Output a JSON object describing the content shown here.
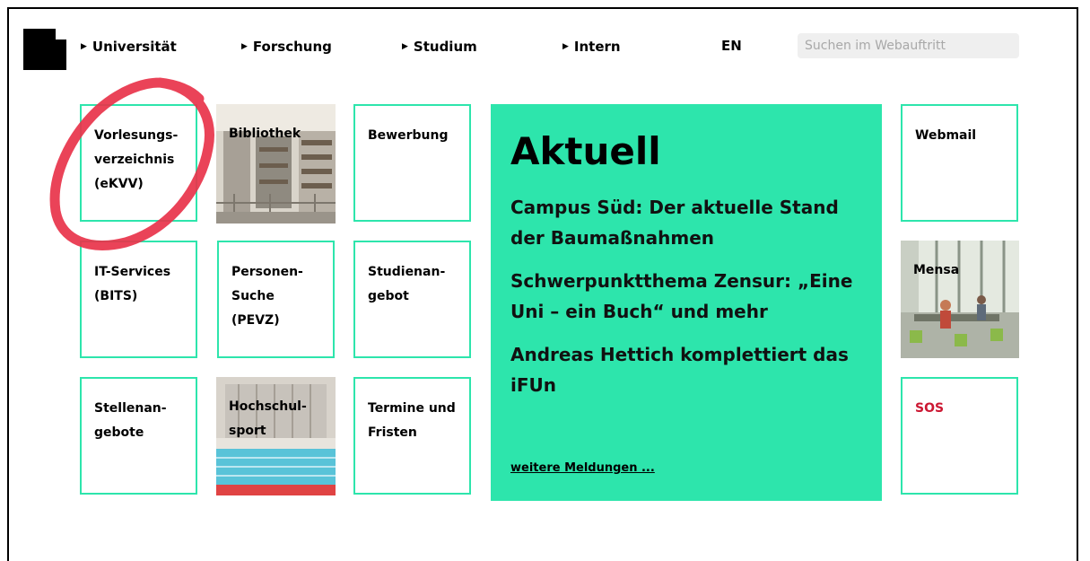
{
  "nav": {
    "items": [
      {
        "label": "Universität"
      },
      {
        "label": "Forschung"
      },
      {
        "label": "Studium"
      },
      {
        "label": "Intern"
      }
    ],
    "lang": "EN",
    "search_placeholder": "Suchen im Webauftritt",
    "caret": "▶"
  },
  "tiles": {
    "vorlesungsverzeichnis": "Vorlesungs-\nverzeichnis\n(eKVV)",
    "bibliothek": "Bibliothek",
    "bewerbung": "Bewerbung",
    "it_services": "IT-Services\n(BITS)",
    "personensuche": "Personen-\nSuche\n(PEVZ)",
    "studienangebot": "Studienan-\ngebot",
    "stellenangebote": "Stellenan-\ngebote",
    "hochschulsport": "Hochschul-\nsport",
    "termine": "Termine und\nFristen",
    "webmail": "Webmail",
    "mensa": "Mensa",
    "sos": "SOS"
  },
  "news": {
    "title": "Aktuell",
    "items": [
      "Campus Süd: Der aktuelle Stand der Baumaßnahmen",
      "Schwerpunktthema Zensur: „Eine Uni – ein Buch“ und mehr",
      "Andreas Hettich komplettiert das iFUn"
    ],
    "more": "weitere Meldungen ..."
  },
  "colors": {
    "accent": "#2de5ac",
    "sos": "#cc1833",
    "annotation": "#e8334a"
  }
}
